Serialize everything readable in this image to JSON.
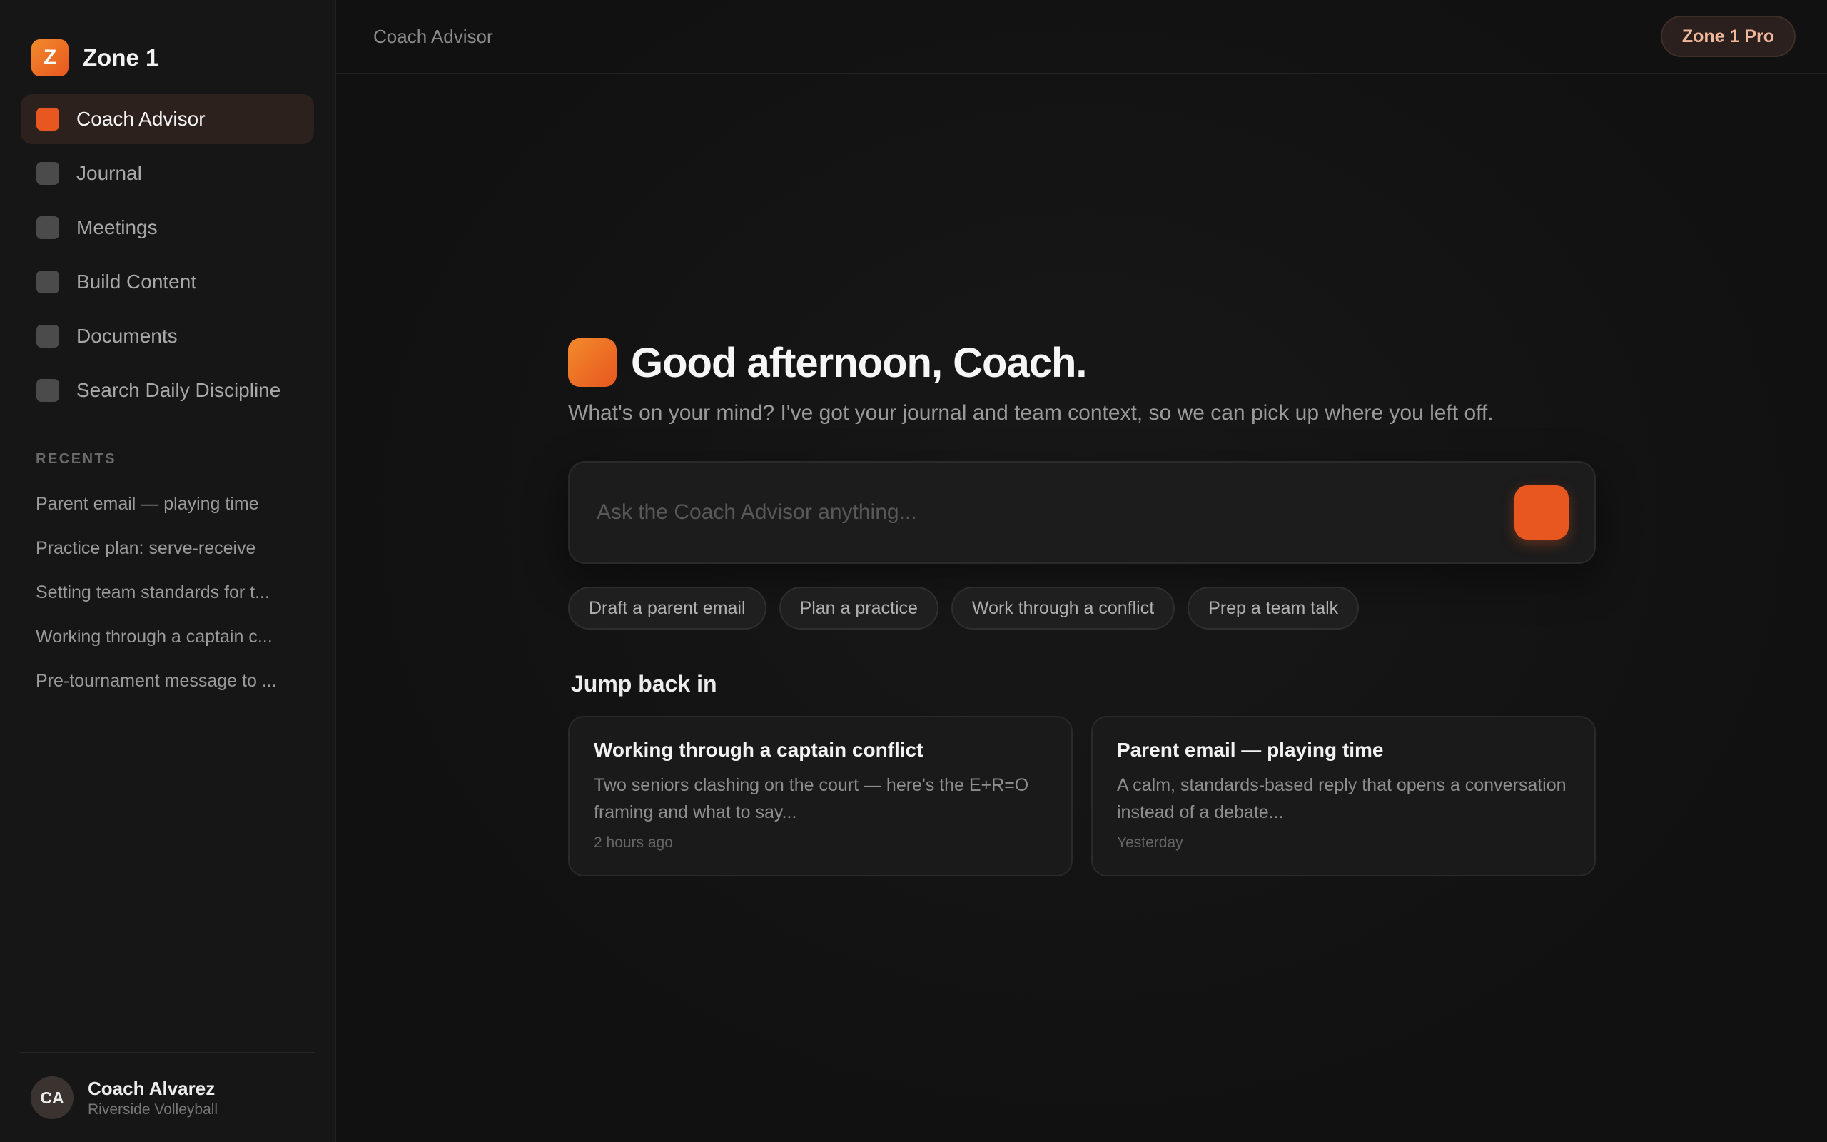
{
  "brand": {
    "logo_letter": "Z",
    "name": "Zone 1"
  },
  "nav": [
    {
      "label": "Coach Advisor",
      "active": true
    },
    {
      "label": "Journal",
      "active": false
    },
    {
      "label": "Meetings",
      "active": false
    },
    {
      "label": "Build Content",
      "active": false
    },
    {
      "label": "Documents",
      "active": false
    },
    {
      "label": "Search Daily Discipline",
      "active": false
    }
  ],
  "recents": {
    "title": "RECENTS",
    "items": [
      "Parent email — playing time",
      "Practice plan: serve-receive",
      "Setting team standards for t...",
      "Working through a captain c...",
      "Pre-tournament message to ..."
    ]
  },
  "user": {
    "initials": "CA",
    "name": "Coach Alvarez",
    "team": "Riverside Volleyball"
  },
  "topbar": {
    "title": "Coach Advisor",
    "badge": "Zone 1 Pro"
  },
  "greeting": {
    "title": "Good afternoon, Coach.",
    "subtitle": "What's on your mind? I've got your journal and team context, so we can pick up where you left off."
  },
  "ask": {
    "placeholder": "Ask the Coach Advisor anything..."
  },
  "chips": [
    "Draft a parent email",
    "Plan a practice",
    "Work through a conflict",
    "Prep a team talk"
  ],
  "jump": {
    "title": "Jump back in",
    "cards": [
      {
        "title": "Working through a captain conflict",
        "body": "Two seniors clashing on the court — here's the E+R=O framing and what to say...",
        "time": "2 hours ago"
      },
      {
        "title": "Parent email — playing time",
        "body": "A calm, standards-based reply that opens a conversation instead of a debate...",
        "time": "Yesterday"
      }
    ]
  },
  "colors": {
    "accent": "#e8571f",
    "accent_light": "#f28a2c",
    "background": "#121212"
  }
}
